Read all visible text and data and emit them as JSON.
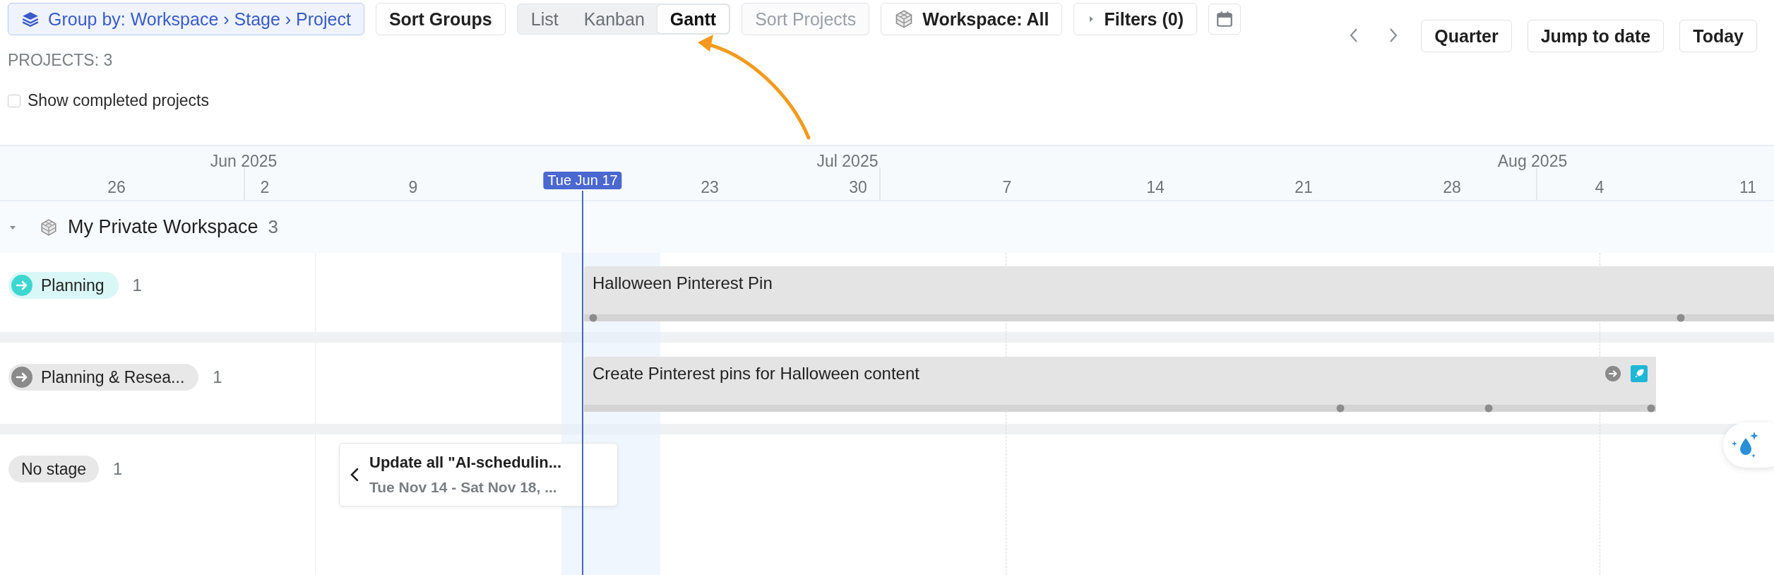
{
  "toolbar": {
    "group_by": "Group by: Workspace › Stage › Project",
    "sort_groups": "Sort Groups",
    "views": [
      {
        "label": "List",
        "selected": false
      },
      {
        "label": "Kanban",
        "selected": false
      },
      {
        "label": "Gantt",
        "selected": true
      }
    ],
    "sort_projects": {
      "label": "Sort Projects",
      "disabled": true
    },
    "workspace": "Workspace: All",
    "filters": {
      "label": "Filters (0)",
      "expanded": false
    }
  },
  "navigation": {
    "zoom": "Quarter",
    "jump": "Jump to date",
    "today": "Today"
  },
  "projects_count": "PROJECTS: 3",
  "show_completed": {
    "label": "Show completed projects",
    "checked": false
  },
  "timeline": {
    "months": [
      "Jun 2025",
      "Jul 2025",
      "Aug 2025"
    ],
    "days": [
      "26",
      "2",
      "9",
      "23",
      "30",
      "7",
      "14",
      "21",
      "28",
      "4",
      "11"
    ],
    "today_label": "Tue Jun 17"
  },
  "workspace_group": {
    "name": "My Private Workspace",
    "count": "3",
    "expanded": true
  },
  "stages": [
    {
      "label": "Planning",
      "count": "1",
      "kind": "icon",
      "color": "#3dd6d0",
      "projects": [
        {
          "kind": "bar",
          "title": "Halloween Pinterest Pin",
          "status_icons": false
        }
      ]
    },
    {
      "label": "Planning & Resea...",
      "count": "1",
      "kind": "icon",
      "color": "#8a8a8a",
      "projects": [
        {
          "kind": "bar",
          "title": "Create Pinterest pins for Halloween content",
          "status_icons": true
        }
      ]
    },
    {
      "label": "No stage",
      "count": "1",
      "kind": "plain",
      "projects": [
        {
          "kind": "offscreen",
          "title": "Update all \"AI-schedulin...",
          "dates": "Tue Nov 14 - Sat Nov 18, ..."
        }
      ]
    }
  ]
}
